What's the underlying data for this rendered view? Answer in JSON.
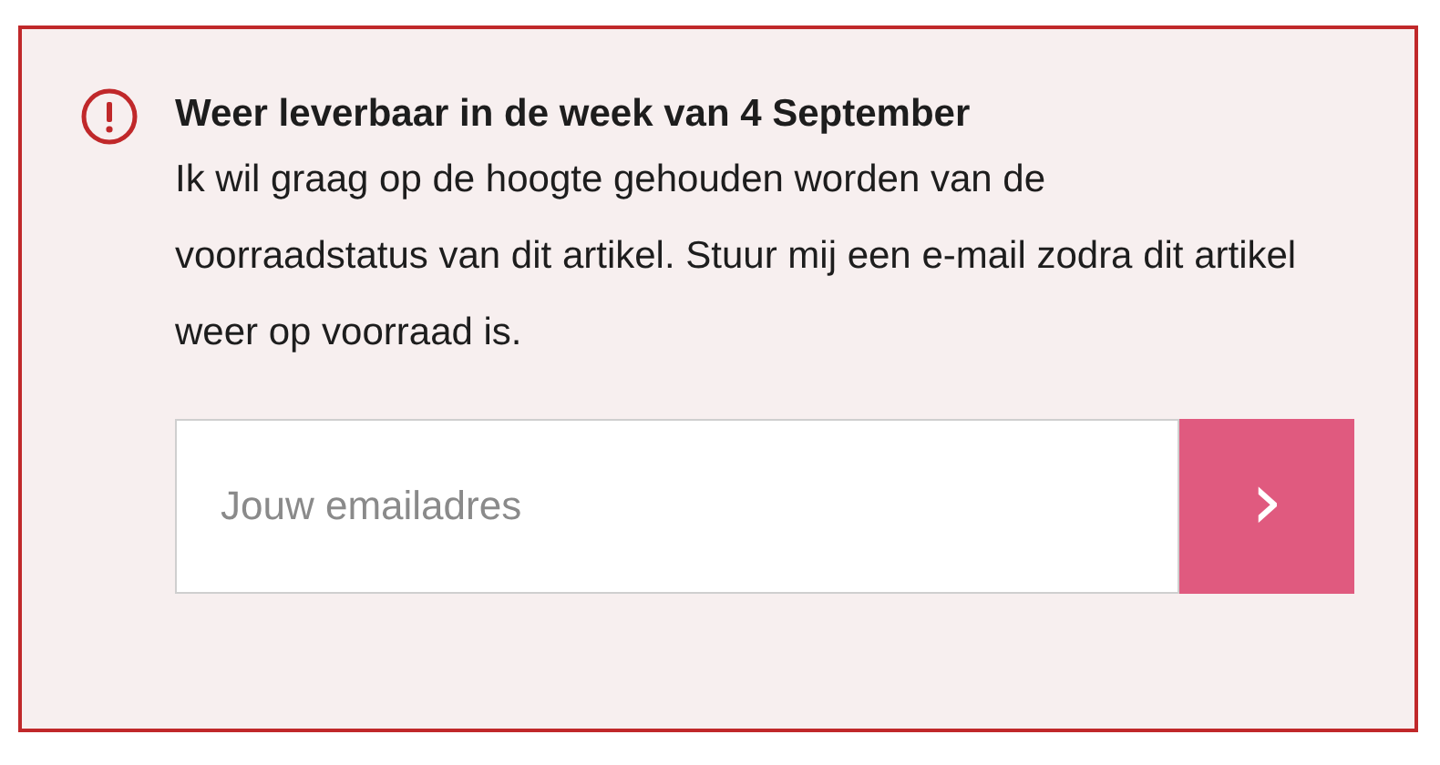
{
  "notice": {
    "title": "Weer leverbaar in de week van 4 September",
    "message": "Ik wil graag op de hoogte gehouden worden van de voorraadstatus van dit artikel. Stuur mij een e-mail zodra dit artikel weer op voorraad is."
  },
  "email_field": {
    "placeholder": "Jouw emailadres"
  },
  "submit_button": {
    "icon": "›"
  }
}
